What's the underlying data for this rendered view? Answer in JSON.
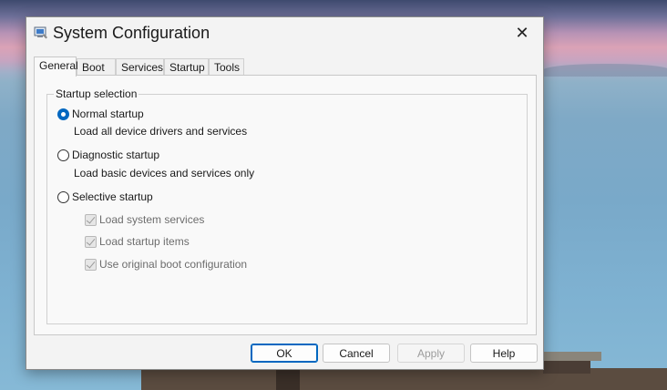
{
  "window": {
    "title": "System Configuration",
    "close_glyph": "✕"
  },
  "tabs": [
    {
      "label": "General",
      "active": true
    },
    {
      "label": "Boot"
    },
    {
      "label": "Services"
    },
    {
      "label": "Startup"
    },
    {
      "label": "Tools"
    }
  ],
  "startup": {
    "group_label": "Startup selection",
    "normal": {
      "label": "Normal startup",
      "desc": "Load all device drivers and services",
      "checked": true
    },
    "diagnostic": {
      "label": "Diagnostic startup",
      "desc": "Load basic devices and services only"
    },
    "selective": {
      "label": "Selective startup"
    },
    "options": [
      {
        "label": "Load system services",
        "checked": true,
        "disabled": true
      },
      {
        "label": "Load startup items",
        "checked": true,
        "disabled": true
      },
      {
        "label": "Use original boot configuration",
        "checked": true,
        "disabled": true
      }
    ]
  },
  "buttons": {
    "ok": "OK",
    "cancel": "Cancel",
    "apply": "Apply",
    "help": "Help"
  },
  "colors": {
    "accent": "#0067c0"
  }
}
